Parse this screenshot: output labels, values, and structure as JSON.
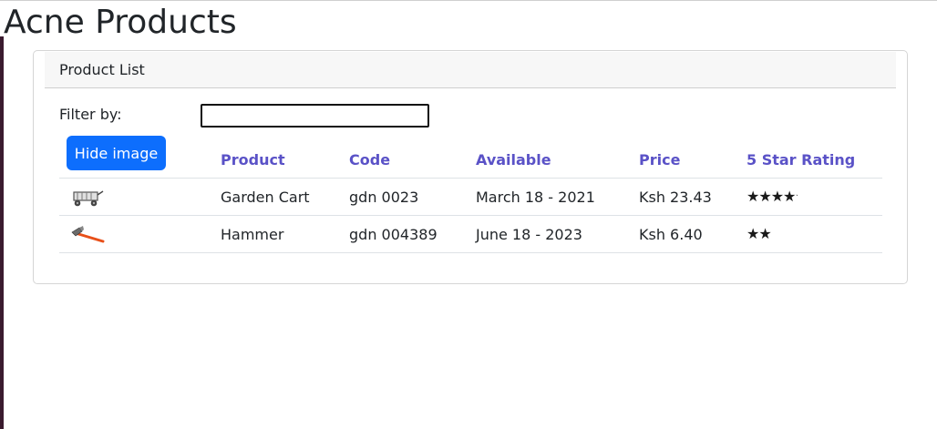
{
  "page": {
    "title": "Acne Products"
  },
  "card": {
    "header": "Product List",
    "filter_label": "Filter by:",
    "filter_value": "",
    "hide_button": "Hide image"
  },
  "table": {
    "columns": [
      "Product",
      "Code",
      "Available",
      "Price",
      "5 Star Rating"
    ],
    "rows": [
      {
        "image_icon": "garden-cart-icon",
        "product": "Garden Cart",
        "code": "gdn 0023",
        "available": "March 18 - 2021",
        "price": "Ksh 23.43",
        "rating": 4.2
      },
      {
        "image_icon": "hammer-icon",
        "product": "Hammer",
        "code": "gdn 004389",
        "available": "June 18 - 2023",
        "price": "Ksh 6.40",
        "rating": 2
      }
    ]
  },
  "colors": {
    "primary_button": "#0d6efd",
    "header_text": "#5a52c7"
  }
}
